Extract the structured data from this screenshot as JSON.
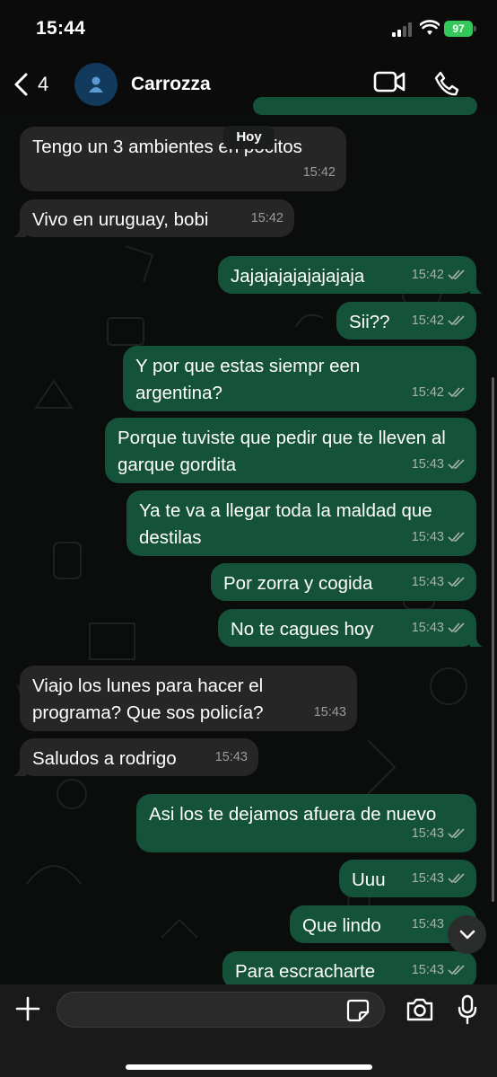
{
  "status_bar": {
    "time": "15:44",
    "battery": "97"
  },
  "header": {
    "back_count": "4",
    "contact_name": "Carrozza"
  },
  "date_chip": "Hoy",
  "messages": [
    {
      "dir": "in",
      "text": "Tengo un 3 ambientes en pocitos",
      "time": "15:42"
    },
    {
      "dir": "in",
      "text": "Vivo en uruguay, bobi",
      "time": "15:42"
    },
    {
      "dir": "out",
      "text": "Jajajajajajajajaja",
      "time": "15:42"
    },
    {
      "dir": "out",
      "text": "Sii??",
      "time": "15:42"
    },
    {
      "dir": "out",
      "text": "Y por que estas siempr een argentina?",
      "time": "15:42"
    },
    {
      "dir": "out",
      "text": "Porque tuviste que pedir que te lleven al garque gordita",
      "time": "15:43"
    },
    {
      "dir": "out",
      "text": "Ya te va a llegar toda la maldad que destilas",
      "time": "15:43"
    },
    {
      "dir": "out",
      "text": "Por zorra y cogida",
      "time": "15:43"
    },
    {
      "dir": "out",
      "text": "No te cagues hoy",
      "time": "15:43"
    },
    {
      "dir": "in",
      "text": "Viajo los lunes para hacer el programa? Que sos policía?",
      "time": "15:43"
    },
    {
      "dir": "in",
      "text": "Saludos a rodrigo",
      "time": "15:43"
    },
    {
      "dir": "out",
      "text": "Asi los te dejamos afuera de nuevo",
      "time": "15:43"
    },
    {
      "dir": "out",
      "text": "Uuu",
      "time": "15:43"
    },
    {
      "dir": "out",
      "text": "Que lindo",
      "time": "15:43"
    },
    {
      "dir": "out",
      "text": "Para escracharte",
      "time": "15:43"
    }
  ],
  "composer": {
    "value": "",
    "placeholder": ""
  },
  "colors": {
    "outgoing_bubble": "#145239",
    "incoming_bubble": "#262626",
    "battery": "#34c759",
    "avatar": "#123a5c"
  },
  "icons": [
    "back-chevron-icon",
    "person-icon",
    "video-camera-icon",
    "phone-icon",
    "plus-icon",
    "sticker-icon",
    "camera-icon",
    "microphone-icon",
    "chevron-down-icon",
    "double-check-icon"
  ]
}
